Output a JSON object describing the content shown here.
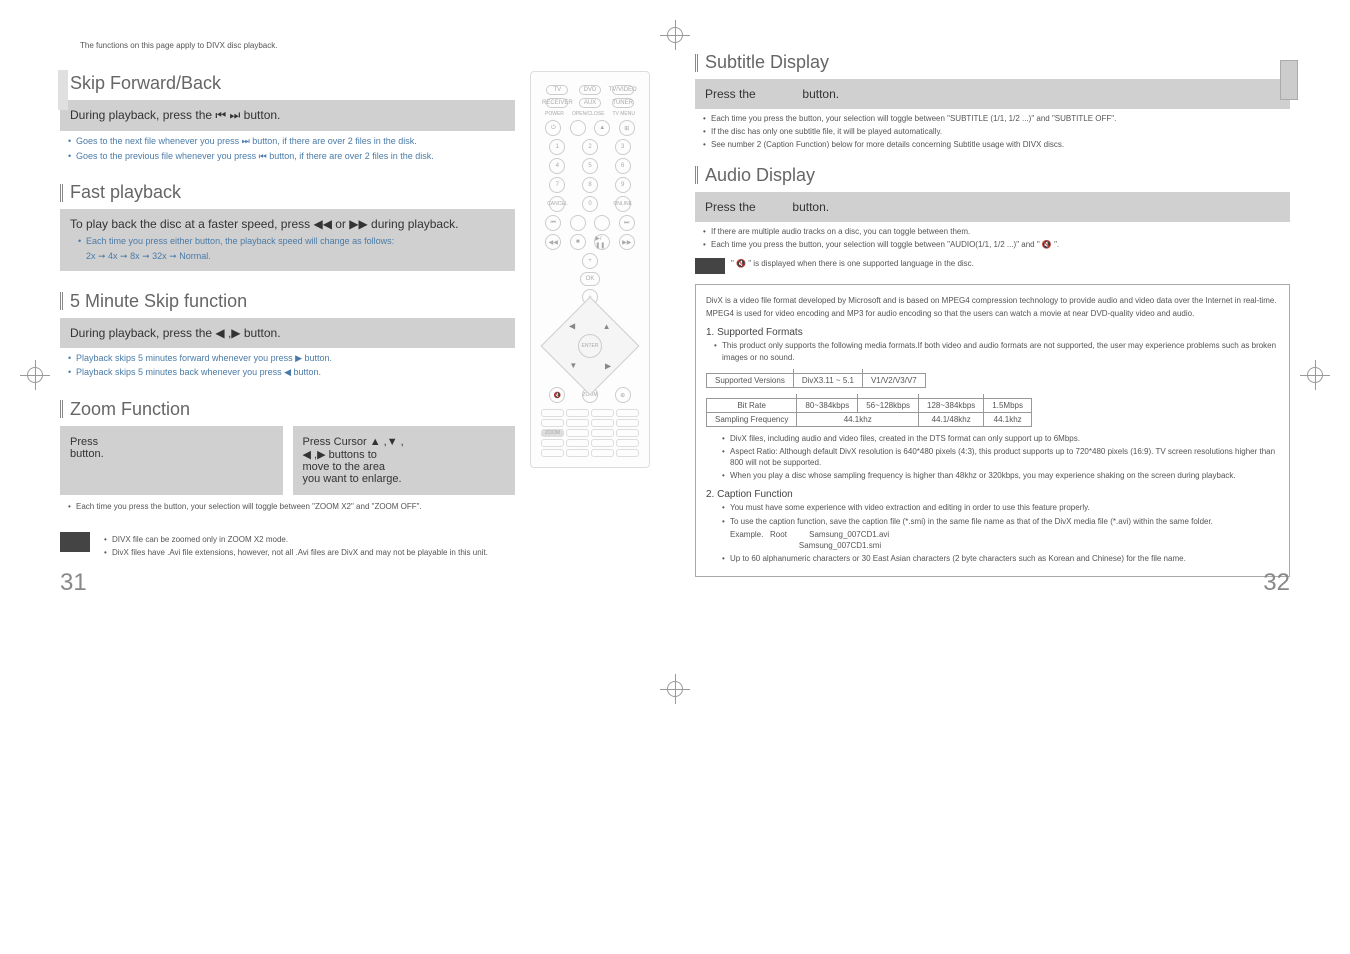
{
  "intro": "The functions on this page apply to DIVX disc playback.",
  "skip": {
    "title": "Skip Forward/Back",
    "heading": "During playback, press the ⏮ ⏭ button.",
    "b1": "Goes to the next file whenever you press ⏭ button, if there are over 2 files in the disk.",
    "b2": "Goes to the previous file whenever you press ⏮ button, if there are over 2 files in the disk."
  },
  "fast": {
    "title": "Fast playback",
    "heading": "To play back the disc at a faster speed, press ◀◀ or ▶▶ during playback.",
    "b1": "Each time you press either button, the playback speed will change as follows:",
    "speeds": "2x ➞ 4x ➞ 8x ➞ 32x ➞ Normal."
  },
  "fivemin": {
    "title": "5 Minute Skip function",
    "heading": "During playback, press the ◀ ,▶ button.",
    "b1": "Playback skips 5 minutes forward whenever you press ▶ button.",
    "b2": "Playback skips 5 minutes back whenever you press ◀ button."
  },
  "zoom": {
    "title": "Zoom Function",
    "box1a": "Press",
    "box1b": "button.",
    "box2a": "Press Cursor ▲ ,▼ ,",
    "box2b": "◀ ,▶ buttons to",
    "box2c": "move to the area",
    "box2d": "you want to enlarge.",
    "note": "Each time you press the button, your selection will toggle between \"ZOOM X2\" and \"ZOOM OFF\"."
  },
  "leftnote": {
    "b1": "DIVX file can be zoomed only in ZOOM X2 mode.",
    "b2": "DivX files have .Avi file extensions, however, not all .Avi files are DivX and may not be playable in this unit."
  },
  "pageleft": "31",
  "pageright": "32",
  "subtitle": {
    "title": "Subtitle Display",
    "press": "Press the",
    "button": "button.",
    "b1": "Each time you press the button, your selection will toggle between \"SUBTITLE (1/1, 1/2 ...)\" and \"SUBTITLE OFF\".",
    "b2": "If the disc has only one subtitle file, it will be played automatically.",
    "b3": "See number 2 (Caption Function) below for more details concerning Subtitle usage with DIVX discs."
  },
  "audio": {
    "title": "Audio Display",
    "press": "Press the",
    "button": "button.",
    "b1": "If there are multiple audio tracks on a disc, you can toggle between them.",
    "b2": "Each time you press the button, your selection will toggle between \"AUDIO(1/1, 1/2 ...)\" and \" 🔇 \".",
    "note": "\" 🔇 \" is displayed when there is one supported language in the disc."
  },
  "divx": {
    "p1": "DivX is a video file format developed by Microsoft and is based on MPEG4 compression technology to provide audio and video data over the Internet in real-time.",
    "p2": "MPEG4 is used for video encoding and MP3 for audio encoding so that the users can watch a movie at near DVD-quality video and audio.",
    "h1": "1. Supported Formats",
    "s1": "This product only supports the following media formats.If both video and audio formats are not supported, the user may experience problems such as broken images or no sound.",
    "tbl1": {
      "h": "Supported Versions",
      "c1": "DivX3.11 ~ 5.1",
      "c2": "V1/V2/V3/V7"
    },
    "tbl2": {
      "r1": [
        "Bit Rate",
        "80~384kbps",
        "56~128kbps",
        "128~384kbps",
        "1.5Mbps"
      ],
      "r2": [
        "Sampling Frequency",
        "44.1khz",
        "44.1/48khz",
        "44.1khz"
      ]
    },
    "sb1": "DivX files, including audio and video files, created in the DTS format can only support up to 6Mbps.",
    "sb2": "Aspect Ratio: Although default DivX resolution is 640*480 pixels (4:3), this product supports up to 720*480 pixels (16:9). TV screen resolutions higher than 800 will not be supported.",
    "sb3": "When you play a disc whose sampling frequency is higher than 48khz or 320kbps, you may experience shaking on the screen during playback.",
    "h2": "2. Caption Function",
    "cb1": "You must have some experience with video extraction and editing in order to use this feature properly.",
    "cb2": "To use the caption function, save the caption file (*.smi) in the same file name as that of the DivX media file (*.avi) within the same folder.",
    "ex1": "Example.   Root          Samsung_007CD1.avi",
    "ex2": "                               Samsung_007CD1.smi",
    "cb3": "Up to 60 alphanumeric characters or 30 East Asian characters (2 byte characters such as Korean and Chinese) for the file name."
  },
  "remote": {
    "enter": "ENTER",
    "power": "POWER",
    "open": "OPEN/CLOSE",
    "tvmenu": "TV MENU"
  }
}
